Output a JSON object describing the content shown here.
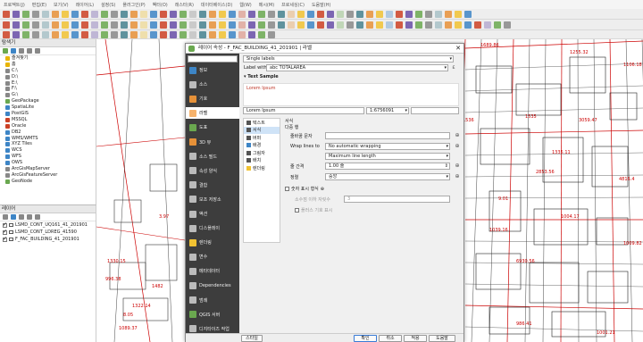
{
  "menubar": [
    "프로젝트(J)",
    "편집(E)",
    "보기(V)",
    "레이어(L)",
    "설정(S)",
    "플러그인(P)",
    "벡터(O)",
    "래스터(R)",
    "데이터베이스(D)",
    "웹(W)",
    "메시(M)",
    "프로세싱(C)",
    "도움말(H)"
  ],
  "browser": {
    "title": "탐색기",
    "items": [
      {
        "label": "즐겨찾기",
        "icon": "star-icon",
        "color": "#e8b400"
      },
      {
        "label": "홈",
        "icon": "folder-icon",
        "color": "#e8b400"
      },
      {
        "label": "C:\\",
        "icon": "drive-icon",
        "color": "#888"
      },
      {
        "label": "D:\\",
        "icon": "drive-icon",
        "color": "#888"
      },
      {
        "label": "E:\\",
        "icon": "drive-icon",
        "color": "#888"
      },
      {
        "label": "F:\\",
        "icon": "drive-icon",
        "color": "#888"
      },
      {
        "label": "G:\\",
        "icon": "drive-icon",
        "color": "#888"
      },
      {
        "label": "GeoPackage",
        "icon": "geopackage-icon",
        "color": "#6aa84f"
      },
      {
        "label": "SpatiaLite",
        "icon": "spatialite-icon",
        "color": "#3d85c6"
      },
      {
        "label": "PostGIS",
        "icon": "postgis-icon",
        "color": "#3d85c6"
      },
      {
        "label": "MSSQL",
        "icon": "mssql-icon",
        "color": "#cc4125"
      },
      {
        "label": "Oracle",
        "icon": "oracle-icon",
        "color": "#cc4125"
      },
      {
        "label": "DB2",
        "icon": "db2-icon",
        "color": "#3d85c6"
      },
      {
        "label": "WMS/WMTS",
        "icon": "wms-icon",
        "color": "#3d85c6"
      },
      {
        "label": "XYZ Tiles",
        "icon": "xyz-icon",
        "color": "#3d85c6"
      },
      {
        "label": "WCS",
        "icon": "wcs-icon",
        "color": "#3d85c6"
      },
      {
        "label": "WFS",
        "icon": "wfs-icon",
        "color": "#3d85c6"
      },
      {
        "label": "OWS",
        "icon": "ows-icon",
        "color": "#3d85c6"
      },
      {
        "label": "ArcGisMapServer",
        "icon": "arcgis-icon",
        "color": "#888"
      },
      {
        "label": "ArcGisFeatureServer",
        "icon": "arcgis-icon",
        "color": "#888"
      },
      {
        "label": "GeoNode",
        "icon": "geonode-icon",
        "color": "#6aa84f"
      }
    ]
  },
  "layers": {
    "title": "레이어",
    "items": [
      {
        "label": "LSMD_CONT_UQ161_41_201901",
        "checked": true,
        "color": "#ffffff"
      },
      {
        "label": "LSMD_CONT_LDREG_41590",
        "checked": true,
        "color": "#ffffff"
      },
      {
        "label": "F_FAC_BUILDING_41_201901",
        "checked": true,
        "color": "#ffffff"
      }
    ]
  },
  "dialog": {
    "title": "레이어 속성 - F_FAC_BUILDING_41_201901 | 라벨",
    "search_placeholder": "",
    "nav": [
      {
        "label": "정보",
        "icon": "info-icon",
        "color": "#3d85c6"
      },
      {
        "label": "소스",
        "icon": "source-icon",
        "color": "#bbb"
      },
      {
        "label": "기호",
        "icon": "symbology-icon",
        "color": "#e69138"
      },
      {
        "label": "라벨",
        "icon": "labels-icon",
        "color": "#f6b26b"
      },
      {
        "label": "도표",
        "icon": "diagrams-icon",
        "color": "#6aa84f"
      },
      {
        "label": "3D 뷰",
        "icon": "3d-view-icon",
        "color": "#e69138"
      },
      {
        "label": "소스 필드",
        "icon": "fields-icon",
        "color": "#bbb"
      },
      {
        "label": "속성 양식",
        "icon": "attributes-form-icon",
        "color": "#bbb"
      },
      {
        "label": "결합",
        "icon": "joins-icon",
        "color": "#bbb"
      },
      {
        "label": "보조 저장소",
        "icon": "auxiliary-storage-icon",
        "color": "#bbb"
      },
      {
        "label": "액션",
        "icon": "actions-icon",
        "color": "#bbb"
      },
      {
        "label": "디스플레이",
        "icon": "display-icon",
        "color": "#bbb"
      },
      {
        "label": "렌더링",
        "icon": "rendering-icon",
        "color": "#f1c232"
      },
      {
        "label": "변수",
        "icon": "variables-icon",
        "color": "#bbb"
      },
      {
        "label": "메타데이터",
        "icon": "metadata-icon",
        "color": "#bbb"
      },
      {
        "label": "Dependencies",
        "icon": "dependencies-icon",
        "color": "#bbb"
      },
      {
        "label": "범례",
        "icon": "legend-icon",
        "color": "#bbb"
      },
      {
        "label": "QGIS 서버",
        "icon": "qgis-server-icon",
        "color": "#6aa84f"
      },
      {
        "label": "디지타이즈 작업",
        "icon": "digitizing-icon",
        "color": "#bbb"
      }
    ],
    "label_mode": "Single labels",
    "label_with_label": "Label with",
    "label_with_value": "abc  TOTALAREA",
    "text_sample_label": "Text Sample",
    "sample_text": "Lorem Ipsum",
    "sample_input": "Lorem Ipsum",
    "scale_value": "1:6756091",
    "subnav": [
      {
        "label": "텍스트",
        "icon": "text-icon",
        "color": "#555"
      },
      {
        "label": "서식",
        "icon": "formatting-icon",
        "color": "#555"
      },
      {
        "label": "버퍼",
        "icon": "buffer-icon",
        "color": "#555"
      },
      {
        "label": "배경",
        "icon": "background-icon",
        "color": "#3d85c6"
      },
      {
        "label": "그림자",
        "icon": "shadow-icon",
        "color": "#555"
      },
      {
        "label": "배치",
        "icon": "placement-icon",
        "color": "#555"
      },
      {
        "label": "렌더링",
        "icon": "rendering-icon",
        "color": "#f1c232"
      }
    ],
    "formatting": {
      "section1": "서식",
      "section2": "다중 행",
      "wrap_char_label": "줄바꿈 문자",
      "wrap_char_value": "",
      "wrap_lines_label": "Wrap lines to",
      "wrap_lines_value": "No automatic wrapping",
      "max_line_value": "Maximum line length",
      "line_height_label": "줄 간격",
      "line_height_value": "1.00 줄",
      "alignment_label": "정렬",
      "alignment_value": "중앙",
      "number_format_label": "숫자 표시 형식",
      "decimal_label": "소수점 이하 자릿수",
      "decimal_value": "3",
      "plus_sign_label": "플러스 기호 표시"
    },
    "buttons": {
      "style": "스타일",
      "ok": "확인",
      "cancel": "취소",
      "apply": "적용",
      "help": "도움말"
    }
  },
  "map_labels": [
    "1689.86",
    "1255.32",
    "1535",
    "3059.47",
    "1335.11",
    "4816.4",
    "2853.56",
    "6930.56",
    "1536",
    "1330.15",
    "996.38",
    "1322.14",
    "1482",
    "1089.37",
    "9.01",
    "1004.17",
    "1001.21",
    "986.41",
    "1106.18",
    "1039.16",
    "1009.82",
    "8.05",
    "3.97"
  ]
}
